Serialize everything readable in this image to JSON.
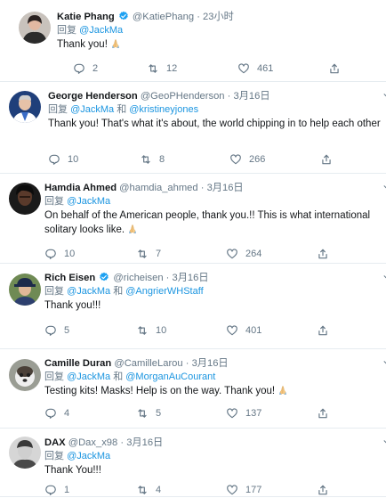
{
  "reply_prefix": "回复",
  "conjunction": "和",
  "tweets": [
    {
      "name": "Katie Phang",
      "handle": "@KatiePhang",
      "dot": "·",
      "time": "23小时",
      "mentions": [
        "@JackMa"
      ],
      "text": "Thank you!",
      "has_emoji": true,
      "verified": true,
      "replies": "2",
      "retweets": "12",
      "likes": "461"
    },
    {
      "name": "George Henderson",
      "handle": "@GeoPHenderson",
      "dot": "·",
      "time": "3月16日",
      "mentions": [
        "@JackMa",
        "@kristineyjones"
      ],
      "text": "Thank you! That's what it's about, the world chipping in to help each other",
      "has_emoji": false,
      "verified": false,
      "replies": "10",
      "retweets": "8",
      "likes": "266"
    },
    {
      "name": "Hamdia Ahmed",
      "handle": "@hamdia_ahmed",
      "dot": "·",
      "time": "3月16日",
      "mentions": [
        "@JackMa"
      ],
      "text": "On behalf of the American people, thank you.!!  This is what international solitary looks like.",
      "has_emoji": true,
      "verified": false,
      "replies": "10",
      "retweets": "7",
      "likes": "264"
    },
    {
      "name": "Rich Eisen",
      "handle": "@richeisen",
      "dot": "·",
      "time": "3月16日",
      "mentions": [
        "@JackMa",
        "@AngrierWHStaff"
      ],
      "text": "Thank you!!!",
      "has_emoji": false,
      "verified": true,
      "replies": "5",
      "retweets": "10",
      "likes": "401"
    },
    {
      "name": "Camille Duran",
      "handle": "@CamilleLarou",
      "dot": "·",
      "time": "3月16日",
      "mentions": [
        "@JackMa",
        "@MorganAuCourant"
      ],
      "text": "Testing kits!  Masks!  Help is on the way. Thank you!",
      "has_emoji": true,
      "verified": false,
      "replies": "4",
      "retweets": "5",
      "likes": "137"
    },
    {
      "name": "DAX",
      "handle": "@Dax_x98",
      "dot": "·",
      "time": "3月16日",
      "mentions": [
        "@JackMa"
      ],
      "text": "Thank You!!!",
      "has_emoji": false,
      "verified": false,
      "replies": "1",
      "retweets": "4",
      "likes": "177"
    }
  ],
  "icons": {
    "reply": "reply-icon",
    "retweet": "retweet-icon",
    "like": "heart-icon",
    "share": "share-icon",
    "caret": "chevron-down-icon",
    "verified": "verified-badge-icon",
    "emoji": "folded-hands-emoji"
  },
  "colors": {
    "link": "#1b95e0",
    "secondary": "#657786",
    "verified": "#1da1f2",
    "divider": "#e6ecf0"
  }
}
